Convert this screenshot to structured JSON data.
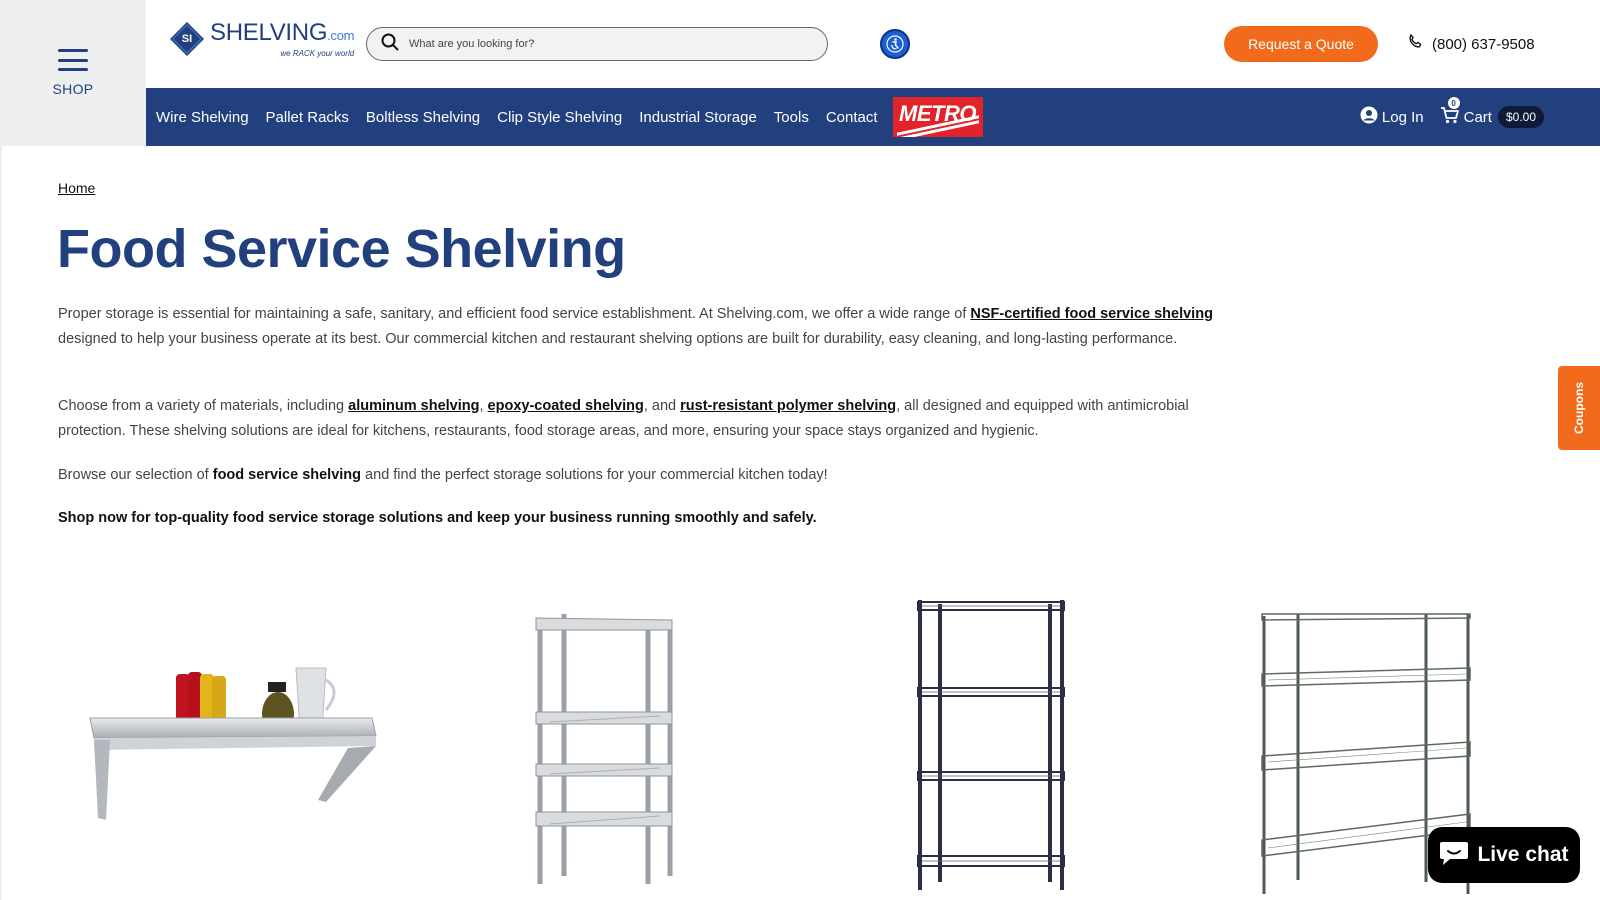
{
  "shop_menu": {
    "label": "SHOP"
  },
  "logo": {
    "name": "SHELVING",
    "domain": ".com",
    "tagline": "we RACK your world",
    "mark_text": "SI"
  },
  "search": {
    "placeholder": "What are you looking for?",
    "value": ""
  },
  "header": {
    "quote_button": "Request a Quote",
    "phone": "(800) 637-9508"
  },
  "nav": {
    "items": [
      {
        "label": "Wire Shelving"
      },
      {
        "label": "Pallet Racks"
      },
      {
        "label": "Boltless Shelving"
      },
      {
        "label": "Clip Style Shelving"
      },
      {
        "label": "Industrial Storage"
      },
      {
        "label": "Tools"
      },
      {
        "label": "Contact"
      }
    ],
    "brand_logo": "METRO",
    "login": "Log In",
    "cart_label": "Cart",
    "cart_count": "0",
    "cart_total": "$0.00"
  },
  "breadcrumb": {
    "home": "Home"
  },
  "page": {
    "title": "Food Service Shelving",
    "p1": {
      "before": "Proper storage is essential for maintaining a safe, sanitary, and efficient food service establishment. At Shelving.com, we offer a wide range of ",
      "link": "NSF-certified food service shelving",
      "after": " designed to help your business operate at its best. Our commercial kitchen and restaurant shelving options are built for durability, easy cleaning, and long-lasting performance."
    },
    "p2": {
      "before": "Choose from a variety of materials, including ",
      "link1": "aluminum shelving",
      "sep1": ", ",
      "link2": "epoxy-coated shelving",
      "sep2": ", and ",
      "link3": "rust-resistant polymer shelving",
      "after": ", all designed and equipped with antimicrobial protection. These shelving solutions are ideal for kitchens, restaurants, food storage areas, and more, ensuring your space stays organized and hygienic."
    },
    "p3": {
      "before": "Browse our selection of ",
      "bold": "food service shelving",
      "after": " and find the perfect storage solutions for your commercial kitchen today!"
    },
    "p4": "Shop now for top-quality food service storage solutions and keep your business running smoothly and safely."
  },
  "products": [
    {
      "icon": "wall-shelf-image"
    },
    {
      "icon": "aluminum-shelving-unit-image"
    },
    {
      "icon": "black-wire-shelving-unit-image"
    },
    {
      "icon": "green-wire-shelving-unit-image"
    }
  ],
  "coupons": {
    "label": "Coupons"
  },
  "livechat": {
    "label": "Live chat"
  },
  "colors": {
    "brand_blue": "#23407e",
    "accent_orange": "#f26a1b",
    "metro_red": "#e2232a"
  }
}
